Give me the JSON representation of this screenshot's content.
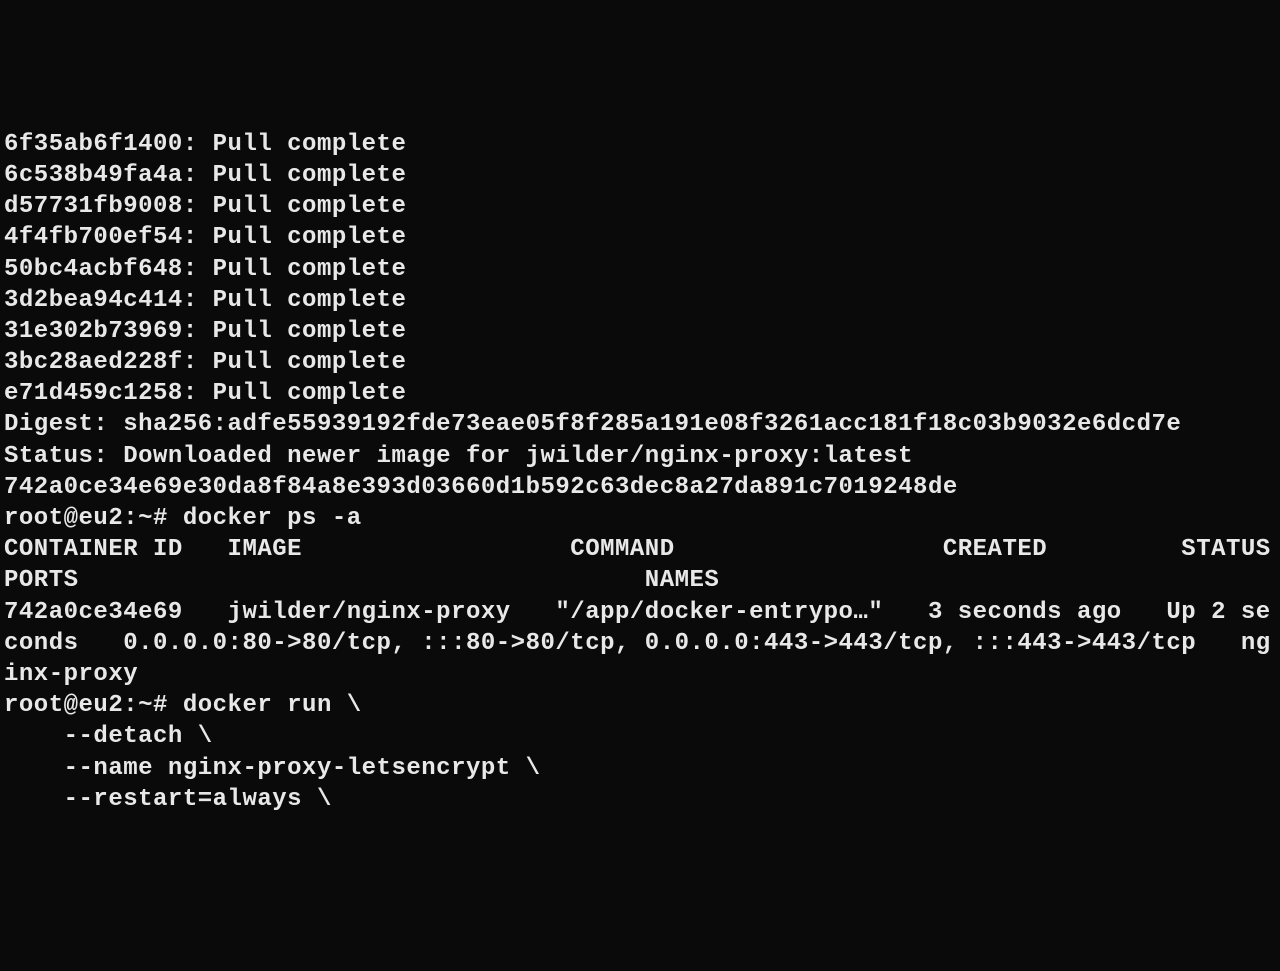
{
  "pull_lines": [
    "6f35ab6f1400: Pull complete",
    "6c538b49fa4a: Pull complete",
    "d57731fb9008: Pull complete",
    "4f4fb700ef54: Pull complete",
    "50bc4acbf648: Pull complete",
    "3d2bea94c414: Pull complete",
    "31e302b73969: Pull complete",
    "3bc28aed228f: Pull complete",
    "e71d459c1258: Pull complete"
  ],
  "digest_line": "Digest: sha256:adfe55939192fde73eae05f8f285a191e08f3261acc181f18c03b9032e6dcd7e",
  "status_line": "Status: Downloaded newer image for jwilder/nginx-proxy:latest",
  "container_hash": "742a0ce34e69e30da8f84a8e393d03660d1b592c63dec8a27da891c7019248de",
  "prompt1": "root@eu2:~# docker ps -a",
  "ps_header": "CONTAINER ID   IMAGE                  COMMAND                  CREATED         STATUS                  PORTS                                      NAMES",
  "ps_row": "742a0ce34e69   jwilder/nginx-proxy   \"/app/docker-entrypo…\"   3 seconds ago   Up 2 seconds   0.0.0.0:80->80/tcp, :::80->80/tcp, 0.0.0.0:443->443/tcp, :::443->443/tcp   nginx-proxy",
  "prompt2": "root@eu2:~# docker run \\",
  "run_line1": "    --detach \\",
  "run_line2": "    --name nginx-proxy-letsencrypt \\",
  "run_line3": "    --restart=always \\"
}
